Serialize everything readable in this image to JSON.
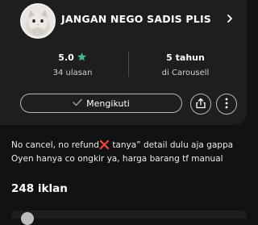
{
  "seller": {
    "name": "JANGAN NEGO SADIS PLIS"
  },
  "stats": {
    "rating": "5.0",
    "reviews_label": "34 ulasan",
    "tenure": "5 tahun",
    "tenure_label": "di Carousell"
  },
  "actions": {
    "follow_label": "Mengikuti"
  },
  "bio": {
    "text": "No cancel, no refund❌ tanya” detail dulu aja gappa\nOyen hanya co ongkir ya, harga barang tf manual"
  },
  "listings": {
    "count_label": "248 iklan"
  },
  "colors": {
    "background": "#121212",
    "card": "#1e1e1e",
    "star": "#3fb98a",
    "border": "#b8b8b8"
  },
  "icons": {
    "rating": "star-icon",
    "follow": "check-icon",
    "share": "share-icon",
    "more": "more-vertical-icon",
    "navigate": "chevron-right-icon"
  }
}
